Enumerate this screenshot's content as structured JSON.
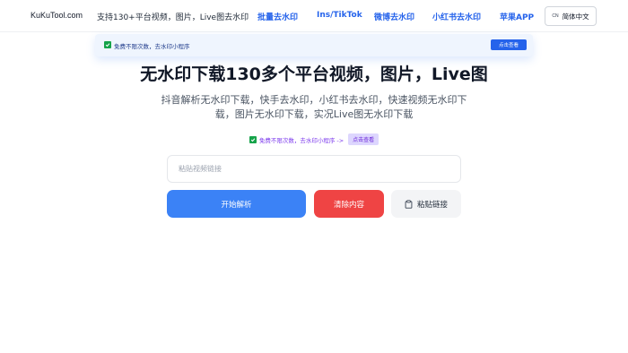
{
  "nav": {
    "brand": "KuKuTool.com",
    "tagline": "支持130+平台视频，图片，Live图去水印",
    "links": [
      "批量去水印",
      "Ins/TikTok",
      "微博去水印",
      "小红书去水印",
      "苹果APP"
    ],
    "lang_code": "CN",
    "lang_label": "简体中文"
  },
  "notice": {
    "text": "免费不限次数，去水印小程序",
    "button": "点击查看"
  },
  "hero": {
    "title": "无水印下载130多个平台视频，图片，Live图",
    "subtitle": "抖音解析无水印下载，快手去水印，小红书去水印，快速视频无水印下载，图片无水印下载，实况Live图无水印下载",
    "promo_text": "免费不限次数，去水印小程序 ->",
    "promo_button": "点击查看"
  },
  "form": {
    "placeholder": "粘贴视频链接",
    "value": "",
    "start_label": "开始解析",
    "clear_label": "清除内容",
    "paste_label": "粘贴链接"
  },
  "colors": {
    "primary": "#3b82f6",
    "link": "#2563eb",
    "danger": "#ef4444",
    "check": "#16a34a",
    "promo": "#7c3aed"
  }
}
